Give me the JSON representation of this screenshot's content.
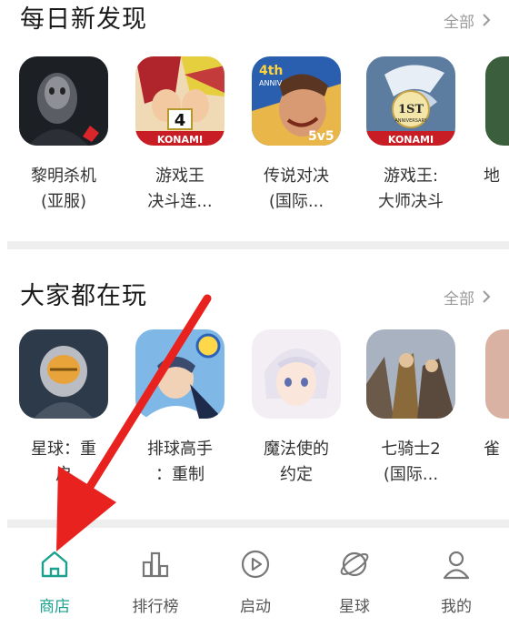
{
  "sections": [
    {
      "title": "每日新发现",
      "see_all": "全部",
      "apps": [
        {
          "name": "黎明杀机\n(亚服)",
          "icon": "dead-by-daylight-icon"
        },
        {
          "name": "游戏王\n决斗连...",
          "icon": "yugioh-duel-links-icon",
          "badge": "KONAMI"
        },
        {
          "name": "传说对决\n(国际...",
          "icon": "arena-of-valor-icon",
          "badge": "4th ANNIV",
          "tag": "5v5"
        },
        {
          "name": "游戏王:\n大师决斗",
          "icon": "yugioh-master-duel-icon",
          "badge": "1ST ANNIVERSARY",
          "brand": "KONAMI"
        },
        {
          "name": "地",
          "icon": "partial-app-icon"
        }
      ]
    },
    {
      "title": "大家都在玩",
      "see_all": "全部",
      "apps": [
        {
          "name": "星球：重\n启",
          "icon": "planet-restart-icon"
        },
        {
          "name": "排球高手\n：重制",
          "icon": "volleyball-icon"
        },
        {
          "name": "魔法使的\n约定",
          "icon": "mahoutsukai-icon"
        },
        {
          "name": "七骑士2\n(国际...",
          "icon": "seven-knights-2-icon"
        },
        {
          "name": "雀",
          "icon": "partial-app-icon"
        }
      ]
    }
  ],
  "tabbar": {
    "active": "store",
    "accent": "#1aa28e",
    "items": [
      {
        "key": "store",
        "label": "商店",
        "icon": "home-icon"
      },
      {
        "key": "ranking",
        "label": "排行榜",
        "icon": "bar-chart-icon"
      },
      {
        "key": "launch",
        "label": "启动",
        "icon": "play-icon"
      },
      {
        "key": "planet",
        "label": "星球",
        "icon": "planet-icon"
      },
      {
        "key": "me",
        "label": "我的",
        "icon": "user-icon"
      }
    ]
  },
  "annotation": {
    "color": "#e8231f",
    "shape": "arrow",
    "points_to": "商店"
  }
}
